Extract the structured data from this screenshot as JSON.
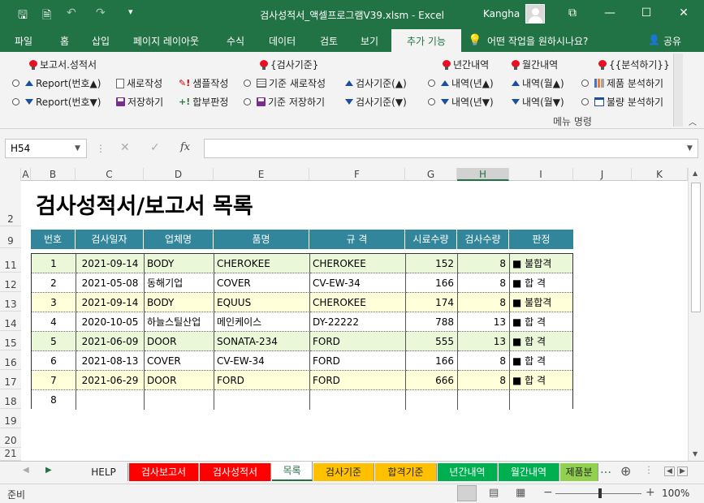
{
  "window": {
    "title": "검사성적서_액셀프로그램V39.xlsm  -  Excel",
    "user": "Kangha",
    "undo_icon": "undo-icon",
    "redo_icon": "redo-icon"
  },
  "ribbon_tabs": [
    "파일",
    "홈",
    "삽입",
    "페이지 레이아웃",
    "수식",
    "데이터",
    "검토",
    "보기",
    "추가 기능"
  ],
  "tell_me": "어떤 작업을 원하시나요?",
  "share": "공유",
  "ribbon": {
    "groups": {
      "report_header": "보고서.성적서",
      "criteria_header": "{검사기준}",
      "yearly_header": "년간내역",
      "monthly_header": "월간내역",
      "analysis_header": "{{분석하기}}"
    },
    "items": {
      "report_up": "Report(번호▲)",
      "report_down": "Report(번호▼)",
      "new_doc": "새로작성",
      "save": "저장하기",
      "sample": "샘플작성",
      "pass_fail": "합부판정",
      "criteria_new": "기준 새로작성",
      "criteria_save": "기준 저장하기",
      "criteria_up": "검사기준(▲)",
      "criteria_down": "검사기준(▼)",
      "year_up": "내역(년▲)",
      "year_down": "내역(년▼)",
      "month_up": "내역(월▲)",
      "month_down": "내역(월▼)",
      "product_analysis": "제품 분석하기",
      "defect_analysis": "불량 분석하기"
    },
    "group_label": "메뉴 명령"
  },
  "formula_bar": {
    "name_box": "H54",
    "formula": "",
    "fx": "fx"
  },
  "columns": [
    "A",
    "B",
    "C",
    "D",
    "E",
    "F",
    "G",
    "H",
    "I",
    "J",
    "K"
  ],
  "rows": [
    "2",
    "9",
    "11",
    "12",
    "13",
    "14",
    "15",
    "16",
    "17",
    "18",
    "19",
    "20",
    "21"
  ],
  "sheet": {
    "title": "검사성적서/보고서 목록",
    "headers": [
      "번호",
      "검사일자",
      "업체명",
      "품명",
      "규  격",
      "시료수량",
      "검사수량",
      "판정"
    ],
    "records": [
      {
        "no": "1",
        "date": "2021-09-14",
        "company": "BODY",
        "product": "CHEROKEE",
        "spec": "CHEROKEE",
        "sample": "152",
        "inspect": "8",
        "result": "■ 불합격"
      },
      {
        "no": "2",
        "date": "2021-05-08",
        "company": "동해기업",
        "product": "COVER",
        "spec": "CV-EW-34",
        "sample": "166",
        "inspect": "8",
        "result": "■ 합 격"
      },
      {
        "no": "3",
        "date": "2021-09-14",
        "company": "BODY",
        "product": "EQUUS",
        "spec": "CHEROKEE",
        "sample": "174",
        "inspect": "8",
        "result": "■ 불합격"
      },
      {
        "no": "4",
        "date": "2020-10-05",
        "company": "하늘스틸산업",
        "product": "메인케이스",
        "spec": "DY-22222",
        "sample": "788",
        "inspect": "13",
        "result": "■ 합 격"
      },
      {
        "no": "5",
        "date": "2021-06-09",
        "company": "DOOR",
        "product": "SONATA-234",
        "spec": "FORD",
        "sample": "555",
        "inspect": "13",
        "result": "■ 합 격"
      },
      {
        "no": "6",
        "date": "2021-08-13",
        "company": "COVER",
        "product": "CV-EW-34",
        "spec": "FORD",
        "sample": "166",
        "inspect": "8",
        "result": "■ 합 격"
      },
      {
        "no": "7",
        "date": "2021-06-29",
        "company": "DOOR",
        "product": "FORD",
        "spec": "FORD",
        "sample": "666",
        "inspect": "8",
        "result": "■ 합 격"
      },
      {
        "no": "8",
        "date": "",
        "company": "",
        "product": "",
        "spec": "",
        "sample": "",
        "inspect": "",
        "result": ""
      }
    ]
  },
  "sheet_tabs": [
    {
      "label": "HELP",
      "color": "#f3f3f3",
      "text": "#222"
    },
    {
      "label": "검사보고서",
      "color": "#ff0000",
      "text": "#fff"
    },
    {
      "label": "검사성적서",
      "color": "#ff0000",
      "text": "#fff"
    },
    {
      "label": "목록",
      "color": "#ffffff",
      "text": "#217346"
    },
    {
      "label": "검사기준",
      "color": "#ffc000",
      "text": "#222"
    },
    {
      "label": "합격기준",
      "color": "#ffc000",
      "text": "#222"
    },
    {
      "label": "년간내역",
      "color": "#00b050",
      "text": "#fff"
    },
    {
      "label": "월간내역",
      "color": "#00b050",
      "text": "#fff"
    },
    {
      "label": "제품분",
      "color": "#92d050",
      "text": "#222"
    }
  ],
  "status": {
    "ready": "준비",
    "zoom": "100%"
  },
  "colors": {
    "excel_green": "#217346",
    "header_teal": "#31869b",
    "row_green": "#ebf7d9",
    "row_yellow": "#ffffd9"
  }
}
